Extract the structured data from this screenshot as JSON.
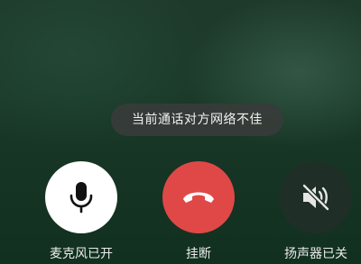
{
  "toast": {
    "text": "当前通话对方网络不佳"
  },
  "controls": {
    "microphone": {
      "label": "麦克风已开",
      "icon": "microphone-icon",
      "state": "on",
      "color": "#ffffff"
    },
    "hangup": {
      "label": "挂断",
      "icon": "phone-hangup-icon",
      "color": "#e04848"
    },
    "speaker": {
      "label": "扬声器已关",
      "icon": "speaker-muted-icon",
      "state": "off",
      "color": "#1f2f27"
    }
  }
}
